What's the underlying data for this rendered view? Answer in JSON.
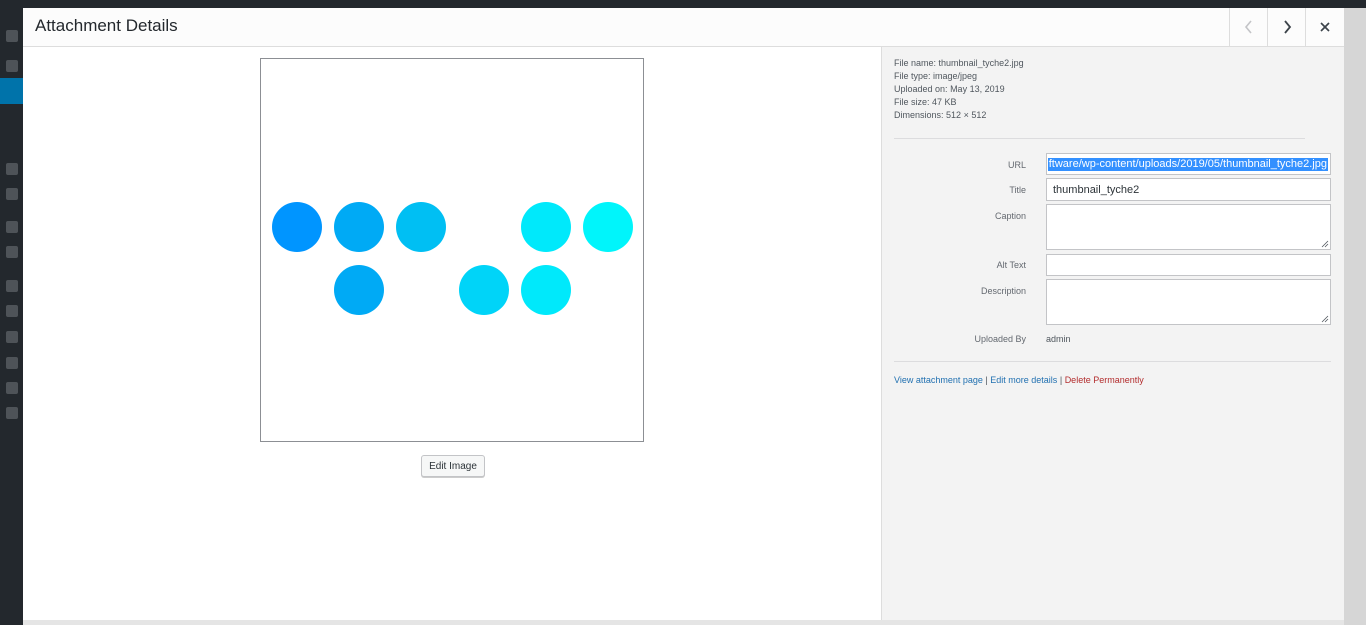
{
  "modal": {
    "title": "Attachment Details",
    "prev_icon": "chevron-left-icon",
    "next_icon": "chevron-right-icon",
    "close_icon": "close-icon"
  },
  "preview": {
    "dot_colors": [
      "#0095ff",
      "#00aaf5",
      "#00bff3",
      "#00d4f8",
      "#00e9fb",
      "#00f5fb"
    ],
    "edit_button": "Edit Image"
  },
  "details": {
    "file_name_label": "File name:",
    "file_name": "thumbnail_tyche2.jpg",
    "file_type_label": "File type:",
    "file_type": "image/jpeg",
    "uploaded_on_label": "Uploaded on:",
    "uploaded_on": "May 13, 2019",
    "file_size_label": "File size:",
    "file_size": "47 KB",
    "dimensions_label": "Dimensions:",
    "dimensions": "512 × 512"
  },
  "form": {
    "url_label": "URL",
    "url_value": "ftware/wp-content/uploads/2019/05/thumbnail_tyche2.jpg",
    "title_label": "Title",
    "title_value": "thumbnail_tyche2",
    "caption_label": "Caption",
    "caption_value": "",
    "alt_label": "Alt Text",
    "alt_value": "",
    "description_label": "Description",
    "description_value": "",
    "uploaded_by_label": "Uploaded By",
    "uploaded_by_value": "admin"
  },
  "actions": {
    "view": "View attachment page",
    "edit_more": "Edit more details",
    "delete": "Delete Permanently",
    "separator": "|"
  },
  "colors": {
    "link": "#2271b1",
    "danger": "#b32d2e",
    "selection": "#3390ff"
  }
}
